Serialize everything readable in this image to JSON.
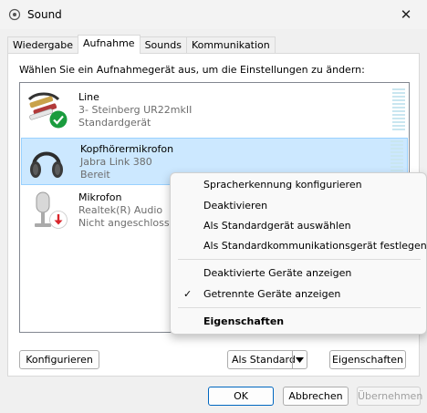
{
  "window": {
    "title": "Sound",
    "close_glyph": "✕"
  },
  "tabs": [
    {
      "label": "Wiedergabe"
    },
    {
      "label": "Aufnahme",
      "active": true
    },
    {
      "label": "Sounds"
    },
    {
      "label": "Kommunikation"
    }
  ],
  "panel": {
    "instruction": "Wählen Sie ein Aufnahmegerät aus, um die Einstellungen zu ändern:"
  },
  "devices": [
    {
      "name": "Line",
      "sub": "3- Steinberg UR22mkII",
      "status": "Standardgerät",
      "icon": "line-in-cable-icon",
      "badge": "default-check-badge",
      "selected": false
    },
    {
      "name": "Kopfhörermikrofon",
      "sub": "Jabra Link 380",
      "status": "Bereit",
      "icon": "headset-icon",
      "badge": "",
      "selected": true
    },
    {
      "name": "Mikrofon",
      "sub": "Realtek(R) Audio",
      "status": "Nicht angeschlossen",
      "icon": "microphone-icon",
      "badge": "unplugged-badge",
      "selected": false
    }
  ],
  "buttons": {
    "configure": "Konfigurieren",
    "set_default": "Als Standard",
    "properties": "Eigenschaften",
    "ok": "OK",
    "cancel": "Abbrechen",
    "apply": "Übernehmen"
  },
  "context_menu": {
    "items": [
      {
        "label": "Spracherkennung konfigurieren"
      },
      {
        "label": "Deaktivieren"
      },
      {
        "label": "Als Standardgerät auswählen"
      },
      {
        "label": "Als Standardkommunikationsgerät festlegen"
      },
      {
        "label": "Deaktivierte Geräte anzeigen"
      },
      {
        "label": "Getrennte Geräte anzeigen",
        "checked": true
      },
      {
        "label": "Eigenschaften",
        "bold": true
      }
    ],
    "check_glyph": "✓"
  },
  "colors": {
    "accent": "#0067c0",
    "selection": "#cce8ff",
    "selection_border": "#99d1ff",
    "default_badge": "#1a9c3e",
    "unplugged_badge": "#d9262c"
  }
}
